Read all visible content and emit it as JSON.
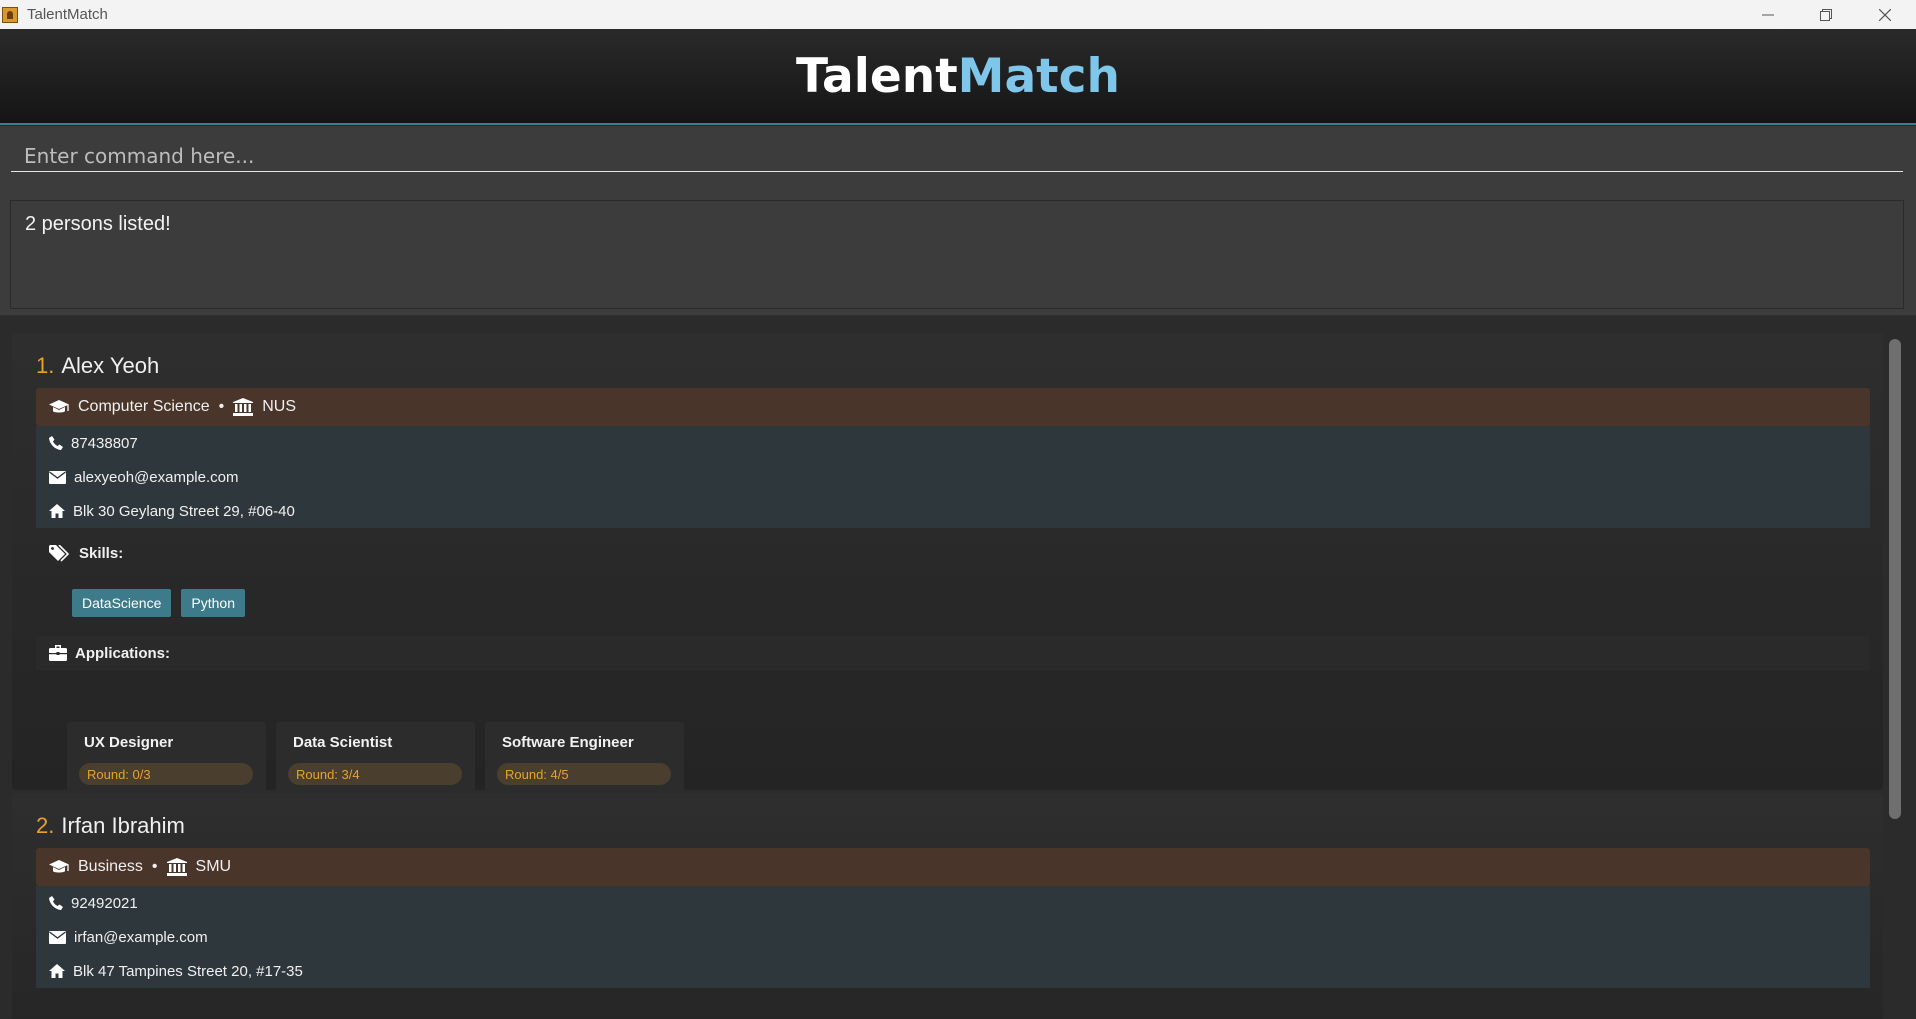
{
  "window": {
    "title": "TalentMatch"
  },
  "banner": {
    "logo_part1": "Talent",
    "logo_part2": "Match"
  },
  "command": {
    "placeholder": "Enter command here..."
  },
  "result": {
    "message": "2 persons listed!"
  },
  "persons": [
    {
      "index": "1.",
      "name": "Alex Yeoh",
      "major": "Computer Science",
      "separator": "•",
      "university": "NUS",
      "phone": "87438807",
      "email": "alexyeoh@example.com",
      "address": "Blk 30 Geylang Street 29, #06-40",
      "skills_label": "Skills:",
      "skills": [
        "DataScience",
        "Python"
      ],
      "applications_label": "Applications:",
      "applications": [
        {
          "role": "UX Designer",
          "round": "Round: 0/3"
        },
        {
          "role": "Data Scientist",
          "round": "Round: 3/4"
        },
        {
          "role": "Software Engineer",
          "round": "Round: 4/5"
        }
      ]
    },
    {
      "index": "2.",
      "name": "Irfan Ibrahim",
      "major": "Business",
      "separator": "•",
      "university": "SMU",
      "phone": "92492021",
      "email": "irfan@example.com",
      "address": "Blk 47 Tampines Street 20, #17-35"
    }
  ],
  "colors": {
    "accent_blue": "#7ec6ea",
    "index_orange": "#e8a22b",
    "education_bg": "#4a352a",
    "contact_bg": "#2e373b",
    "tag_bg": "#3d7a8a"
  }
}
